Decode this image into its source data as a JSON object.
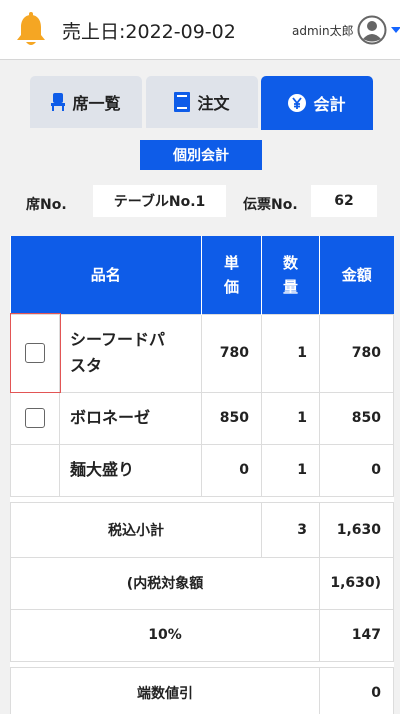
{
  "header": {
    "sales_date": "売上日:2022-09-02",
    "user_name": "admin太郎",
    "colors": {
      "bell": "#f5a623",
      "accent": "#0e5ce8"
    }
  },
  "tabs": [
    {
      "label": "席一覧",
      "icon": "chair-icon"
    },
    {
      "label": "注文",
      "icon": "notebook-icon"
    },
    {
      "label": "会計",
      "icon": "yen-icon",
      "active": true
    }
  ],
  "badge": "個別会計",
  "info": {
    "seat_label": "席No.",
    "seat_value": "テーブルNo.1",
    "slip_label": "伝票No.",
    "slip_value": "62"
  },
  "table": {
    "headers": {
      "name": "品名",
      "price": "単\n価",
      "qty": "数\n量",
      "amount": "金額"
    },
    "items": [
      {
        "checkbox": true,
        "name": "シーフードパ\nスタ",
        "price": "780",
        "qty": "1",
        "amount": "780"
      },
      {
        "checkbox": true,
        "name": "ボロネーゼ",
        "price": "850",
        "qty": "1",
        "amount": "850"
      },
      {
        "checkbox": false,
        "name": "麺大盛り",
        "price": "0",
        "qty": "1",
        "amount": "0"
      }
    ],
    "subtotal": {
      "label": "税込小計",
      "qty": "3",
      "amount": "1,630"
    },
    "taxable": {
      "label": "(内税対象額",
      "amount": "1,630)"
    },
    "tax_rate": {
      "label": "10%",
      "amount": "147"
    },
    "rounding": {
      "label": "端数値引",
      "amount": "0"
    }
  }
}
